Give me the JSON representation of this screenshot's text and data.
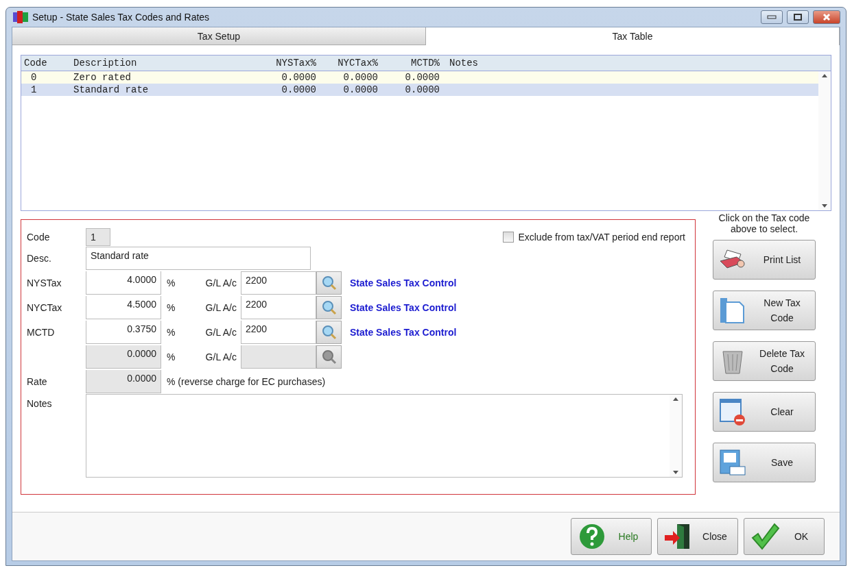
{
  "window": {
    "title": "Setup - State Sales Tax Codes and Rates"
  },
  "tabs": [
    {
      "label": "Tax Setup",
      "selected": false
    },
    {
      "label": "Tax Table",
      "selected": true
    }
  ],
  "table": {
    "columns": [
      "Code",
      "Description",
      "NYSTax%",
      "NYCTax%",
      "MCTD%",
      "Notes"
    ],
    "rows": [
      {
        "cells": [
          "0",
          "Zero rated",
          "0.0000",
          "0.0000",
          "0.0000"
        ],
        "selected": false
      },
      {
        "cells": [
          "1",
          "Standard rate",
          "0.0000",
          "0.0000",
          "0.0000"
        ],
        "selected": true
      }
    ]
  },
  "form": {
    "code": {
      "label": "Code",
      "value": "1"
    },
    "exclude": {
      "label": "Exclude from tax/VAT period end report",
      "checked": false
    },
    "desc": {
      "label": "Desc.",
      "value": "Standard rate"
    },
    "tax_lines": [
      {
        "label": "NYSTax",
        "rate": "4.0000",
        "unit": "%",
        "gl_label": "G/L A/c",
        "account": "2200",
        "account_name": "State Sales Tax Control",
        "disabled": false
      },
      {
        "label": "NYCTax",
        "rate": "4.5000",
        "unit": "%",
        "gl_label": "G/L A/c",
        "account": "2200",
        "account_name": "State Sales Tax Control",
        "disabled": false
      },
      {
        "label": "MCTD",
        "rate": "0.3750",
        "unit": "%",
        "gl_label": "G/L A/c",
        "account": "2200",
        "account_name": "State Sales Tax Control",
        "disabled": false
      },
      {
        "rate": "0.0000",
        "unit": "%",
        "gl_label": "G/L A/c",
        "disabled": true
      }
    ],
    "rate": {
      "label": "Rate",
      "value": "0.0000",
      "note": "% (reverse charge for EC purchases)"
    },
    "notes": {
      "label": "Notes"
    }
  },
  "hint": "Click on the Tax code above to select.",
  "side_buttons": [
    {
      "label": "Print List"
    },
    {
      "label": "New Tax Code"
    },
    {
      "label": "Delete Tax Code"
    },
    {
      "label": "Clear"
    },
    {
      "label": "Save"
    }
  ],
  "footer_buttons": [
    {
      "label": "Help"
    },
    {
      "label": "Close"
    },
    {
      "label": "OK"
    }
  ]
}
